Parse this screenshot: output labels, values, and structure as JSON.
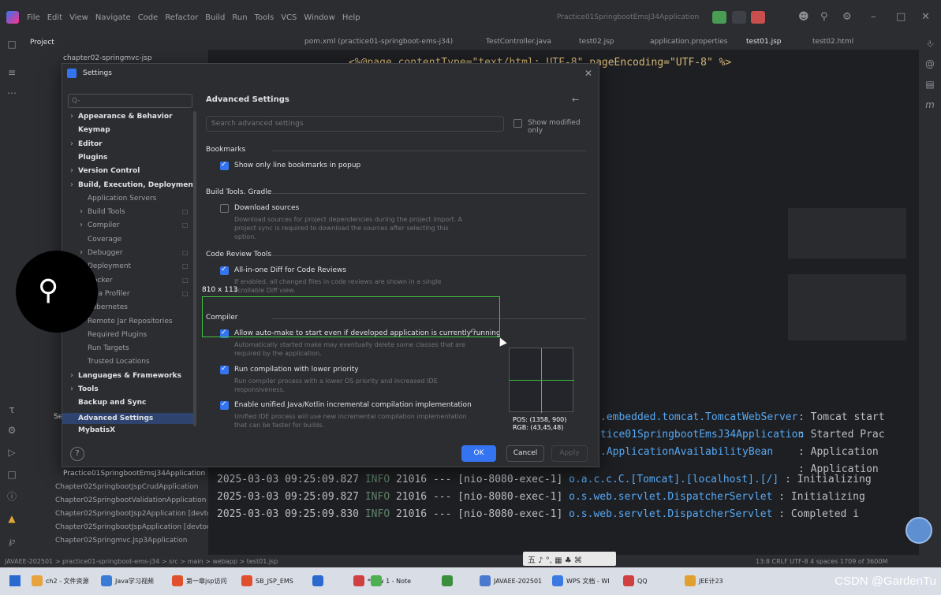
{
  "menubar": {
    "items": [
      "File",
      "Edit",
      "View",
      "Navigate",
      "Code",
      "Refactor",
      "Build",
      "Run",
      "Tools",
      "VCS",
      "Window",
      "Help"
    ],
    "run_config": "Practice01SpringbootEmsJ34Application"
  },
  "project": {
    "header": "Project",
    "rows": [
      "chapter02-springmvc-jsp"
    ],
    "run_rows": [
      "Practice01SpringbootEmsJ34Application",
      "Chapter02SpringbootJspCrudApplication",
      "Chapter02SpringbootValidationApplication",
      "Chapter02SpringbootJsp2Application [devtools]",
      "Chapter02SpringbootJspApplication [devtools]",
      "Chapter02Springmvc.Jsp3Application"
    ],
    "services_label": "Services"
  },
  "tabs": [
    "pom.xml (practice01-springboot-ems-j34)",
    "TestController.java",
    "test02.jsp",
    "application.properties",
    "test01.jsp",
    "test02.html"
  ],
  "editor": {
    "line1": "<%@page contentType=\"text/html; UTF-8\" pageEncoding=\"UTF-8\" %>"
  },
  "logs": [
    {
      "time": "2025-03-03 09:25:09.827",
      "level": "INFO",
      "pid": "21016",
      "sep": "---",
      "thread": "[nio-8080-exec-1]",
      "logger": "o.a.c.c.C.[Tomcat].[localhost].[/]",
      "msg": ": Initializing"
    },
    {
      "time": "2025-03-03 09:25:09.827",
      "level": "INFO",
      "pid": "21016",
      "sep": "---",
      "thread": "[nio-8080-exec-1]",
      "logger": "o.s.web.servlet.DispatcherServlet",
      "msg": ": Initializing"
    },
    {
      "time": "2025-03-03 09:25:09.830",
      "level": "INFO",
      "pid": "21016",
      "sep": "---",
      "thread": "[nio-8080-exec-1]",
      "logger": "o.s.web.servlet.DispatcherServlet",
      "msg": ": Completed i"
    }
  ],
  "log_right": [
    {
      "logger": ".embedded.tomcat.TomcatWebServer",
      "msg": ": Tomcat start"
    },
    {
      "logger": "tice01SpringbootEmsJ34Application",
      "msg": ": Started Prac"
    },
    {
      "logger": ".ApplicationAvailabilityBean",
      "msg": ": Application"
    },
    {
      "logger": "",
      "msg": ": Application"
    }
  ],
  "dialog": {
    "title": "Settings",
    "search_placeholder": "Q-",
    "nav": [
      {
        "label": "Appearance & Behavior",
        "style": "b",
        "indent": 0,
        "arrow": true
      },
      {
        "label": "Keymap",
        "style": "b",
        "indent": 0,
        "arrow": false
      },
      {
        "label": "Editor",
        "style": "b",
        "indent": 0,
        "arrow": true
      },
      {
        "label": "Plugins",
        "style": "b",
        "indent": 0,
        "arrow": false
      },
      {
        "label": "Version Control",
        "style": "b",
        "indent": 0,
        "arrow": true
      },
      {
        "label": "Build, Execution, Deployment",
        "style": "b",
        "indent": 0,
        "arrow": true
      },
      {
        "label": "Application Servers",
        "style": "n",
        "indent": 1,
        "arrow": false
      },
      {
        "label": "Build Tools",
        "style": "n",
        "indent": 1,
        "arrow": true
      },
      {
        "label": "Compiler",
        "style": "n",
        "indent": 1,
        "arrow": true
      },
      {
        "label": "Coverage",
        "style": "n",
        "indent": 1,
        "arrow": false
      },
      {
        "label": "Debugger",
        "style": "n",
        "indent": 1,
        "arrow": true
      },
      {
        "label": "Deployment",
        "style": "n",
        "indent": 1,
        "arrow": true
      },
      {
        "label": "Docker",
        "style": "n",
        "indent": 1,
        "arrow": true
      },
      {
        "label": "Java Profiler",
        "style": "n",
        "indent": 1,
        "arrow": true
      },
      {
        "label": "Kubernetes",
        "style": "n",
        "indent": 1,
        "arrow": false
      },
      {
        "label": "Remote Jar Repositories",
        "style": "n",
        "indent": 1,
        "arrow": false
      },
      {
        "label": "Required Plugins",
        "style": "n",
        "indent": 1,
        "arrow": false
      },
      {
        "label": "Run Targets",
        "style": "n",
        "indent": 1,
        "arrow": false
      },
      {
        "label": "Trusted Locations",
        "style": "n",
        "indent": 1,
        "arrow": false
      },
      {
        "label": "Languages & Frameworks",
        "style": "b",
        "indent": 0,
        "arrow": true
      },
      {
        "label": "Tools",
        "style": "b",
        "indent": 0,
        "arrow": true
      },
      {
        "label": "Backup and Sync",
        "style": "b",
        "indent": 0,
        "arrow": false
      },
      {
        "label": "Advanced Settings",
        "style": "sel",
        "indent": 0,
        "arrow": false
      },
      {
        "label": "MybatisX",
        "style": "b",
        "indent": 0,
        "arrow": false
      }
    ],
    "content": {
      "heading": "Advanced Settings",
      "search_placeholder": "Search advanced settings",
      "show_modified": "Show modified only",
      "sections": [
        {
          "title": "Bookmarks",
          "options": [
            {
              "label": "Show only line bookmarks in popup",
              "checked": true,
              "desc": ""
            }
          ]
        },
        {
          "title": "Build Tools. Gradle",
          "options": [
            {
              "label": "Download sources",
              "checked": false,
              "desc": "Download sources for project dependencies during the project import. A project sync is required to download the sources after selecting this option."
            }
          ]
        },
        {
          "title": "Code Review Tools",
          "options": [
            {
              "label": "All-in-one Diff for Code Reviews",
              "checked": true,
              "desc": "If enabled, all changed files in code reviews are shown in a single scrollable Diff view."
            }
          ]
        },
        {
          "title": "Compiler",
          "options": [
            {
              "label": "Allow auto-make to start even if developed application is currently running",
              "checked": true,
              "desc": "Automatically started make may eventually delete some classes that are required by the application."
            },
            {
              "label": "Run compilation with lower priority",
              "checked": true,
              "desc": "Run compiler process with a lower OS priority and increased IDE responsiveness."
            },
            {
              "label": "Enable unified Java/Kotlin incremental compilation implementation",
              "checked": true,
              "desc": "Unified IDE process will use new incremental compilation implementation that can be faster for builds."
            }
          ]
        }
      ]
    },
    "ok": "OK",
    "cancel": "Cancel",
    "apply": "Apply"
  },
  "overlay": {
    "size_label": "810 x 113",
    "pos": "POS: (1358, 900)",
    "rgb": "RGB: (43,45,48)"
  },
  "statusbar": {
    "path": "JAVAEE-202501 > practice01-springboot-ems-j34 > src > main > webapp > test01.jsp",
    "right": "13:8   CRLF   UTF-8   4 spaces   1709 of 3600M"
  },
  "ime": "五 ♪ °, ▦ ♣ ⌘",
  "taskbar": {
    "items": [
      "ch2 - 文件资源",
      "Java学习视频",
      "第一章jsp访问",
      "SB_JSP_EMS",
      "",
      " *new 1 - Note",
      "",
      "",
      "JAVAEE-202501",
      "WPS 文档 - WI",
      "QQ",
      "JEE计23"
    ]
  },
  "watermark": "CSDN @GardenTu"
}
